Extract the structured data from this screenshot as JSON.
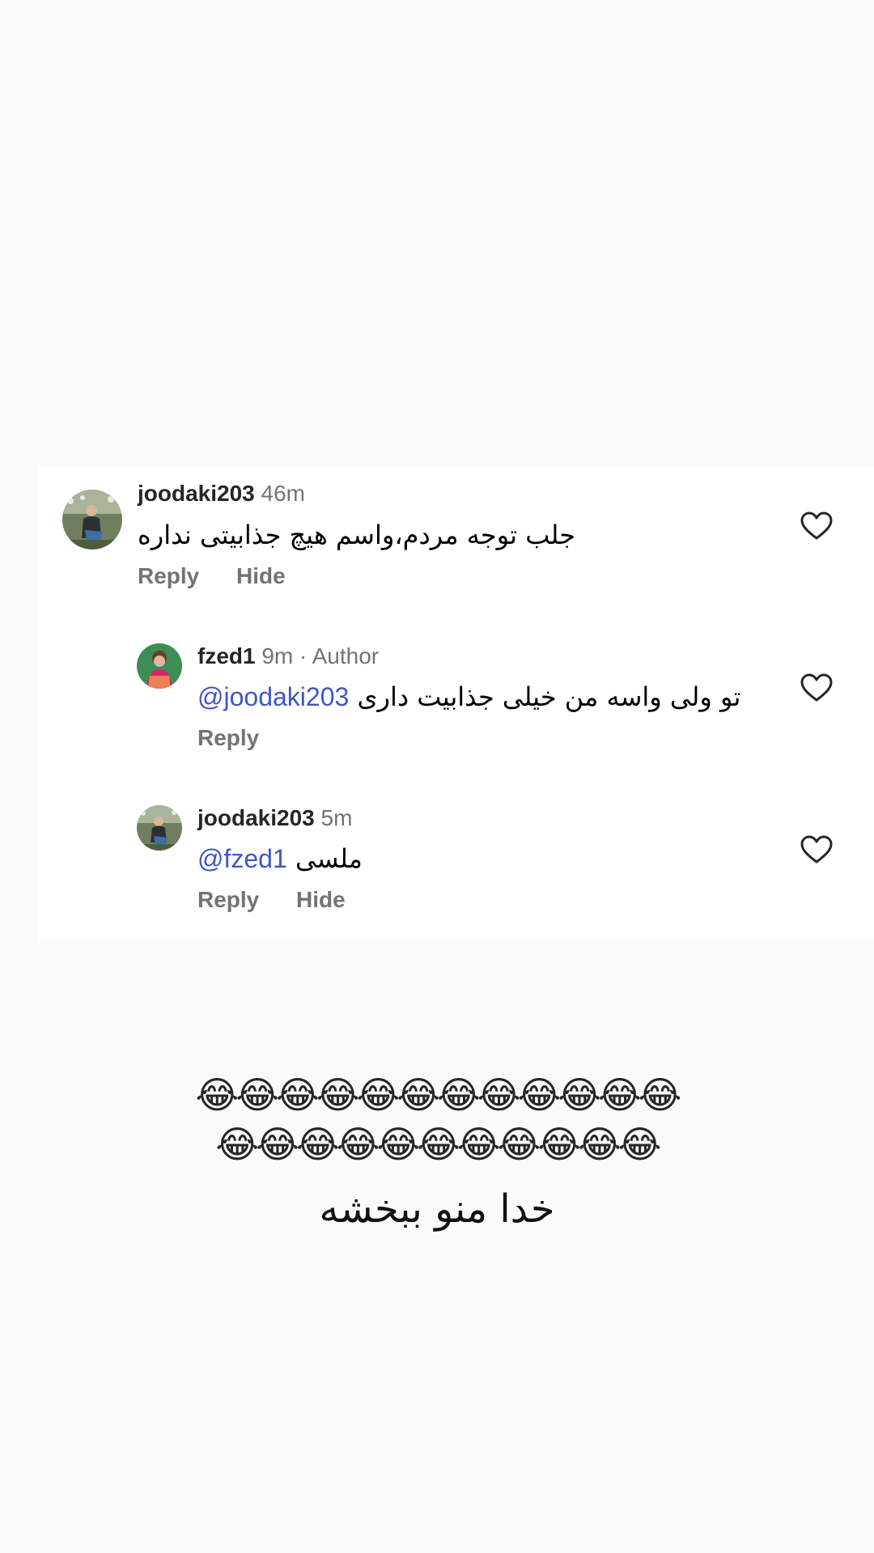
{
  "comments": [
    {
      "username": "joodaki203",
      "time": "46m",
      "author_tag": "",
      "mention": "",
      "text": "جلب توجه مردم،واسم هیچ جذابیتی نداره",
      "reply_label": "Reply",
      "hide_label": "Hide",
      "avatar_icon": "profile-photo"
    },
    {
      "username": "fzed1",
      "time": "9m",
      "author_tag": "· Author",
      "mention": "@joodaki203",
      "text": "تو ولی واسه من خیلی جذابیت داری",
      "reply_label": "Reply",
      "hide_label": "",
      "avatar_icon": "profile-photo"
    },
    {
      "username": "joodaki203",
      "time": "5m",
      "author_tag": "",
      "mention": "@fzed1",
      "text": "ملسی",
      "reply_label": "Reply",
      "hide_label": "Hide",
      "avatar_icon": "profile-photo"
    }
  ],
  "icons": {
    "like": "heart-outline-icon"
  },
  "emoji_rows": [
    "😂😂😂😂😂😂😂😂😂😂😂😂",
    "😂😂😂😂😂😂😂😂😂😂😂"
  ],
  "caption": "خدا منو ببخشه",
  "colors": {
    "background": "#fafafa",
    "card": "#ffffff",
    "mention": "#4156c5",
    "secondary_text": "#737373"
  }
}
